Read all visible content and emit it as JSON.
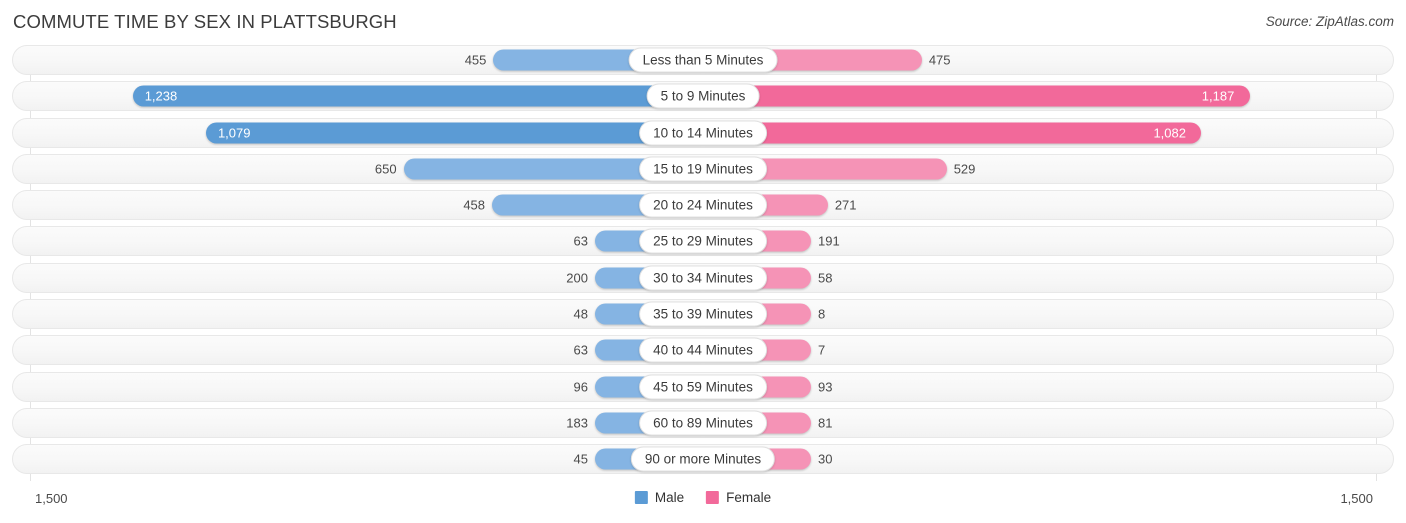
{
  "header": {
    "title": "COMMUTE TIME BY SEX IN PLATTSBURGH",
    "source": "Source: ZipAtlas.com"
  },
  "axis": {
    "left_label": "1,500",
    "right_label": "1,500",
    "max": 1500
  },
  "legend": [
    {
      "label": "Male",
      "color": "#5b9bd5"
    },
    {
      "label": "Female",
      "color": "#f2699a"
    }
  ],
  "colors": {
    "male_light": "#85b4e3",
    "male_strong": "#5b9bd5",
    "female_light": "#f593b6",
    "female_strong": "#f2699a"
  },
  "chart_data": {
    "type": "bar",
    "orientation": "horizontal-diverging",
    "title": "COMMUTE TIME BY SEX IN PLATTSBURGH",
    "xlabel": "",
    "ylabel": "",
    "xlim": [
      1500,
      1500
    ],
    "grid": true,
    "legend_position": "bottom-center",
    "categories": [
      "Less than 5 Minutes",
      "5 to 9 Minutes",
      "10 to 14 Minutes",
      "15 to 19 Minutes",
      "20 to 24 Minutes",
      "25 to 29 Minutes",
      "30 to 34 Minutes",
      "35 to 39 Minutes",
      "40 to 44 Minutes",
      "45 to 59 Minutes",
      "60 to 89 Minutes",
      "90 or more Minutes"
    ],
    "series": [
      {
        "name": "Male",
        "values": [
          455,
          1238,
          1079,
          650,
          458,
          63,
          200,
          48,
          63,
          96,
          183,
          45
        ],
        "labels": [
          "455",
          "1,238",
          "1,079",
          "650",
          "458",
          "63",
          "200",
          "48",
          "63",
          "96",
          "183",
          "45"
        ]
      },
      {
        "name": "Female",
        "values": [
          475,
          1187,
          1082,
          529,
          271,
          191,
          58,
          8,
          7,
          93,
          81,
          30
        ],
        "labels": [
          "475",
          "1,187",
          "1,082",
          "529",
          "271",
          "191",
          "58",
          "8",
          "7",
          "93",
          "81",
          "30"
        ]
      }
    ]
  }
}
